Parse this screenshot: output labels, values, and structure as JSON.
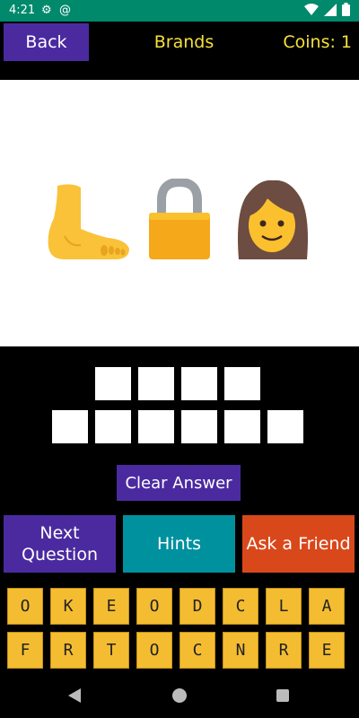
{
  "status_bar": {
    "time": "4:21"
  },
  "header": {
    "back_label": "Back",
    "category": "Brands",
    "coins": "Coins: 1"
  },
  "puzzle": {
    "emojis": [
      "foot-emoji",
      "lock-emoji",
      "woman-emoji"
    ],
    "answer_rows": [
      4,
      6
    ]
  },
  "buttons": {
    "clear": "Clear Answer",
    "next": "Next Question",
    "hints": "Hints",
    "ask": "Ask a Friend"
  },
  "letters": {
    "row1": [
      "O",
      "K",
      "E",
      "O",
      "D",
      "C",
      "L",
      "A"
    ],
    "row2": [
      "F",
      "R",
      "T",
      "O",
      "C",
      "N",
      "R",
      "E"
    ]
  },
  "colors": {
    "accent_purple": "#4b2aa0",
    "hint_teal": "#00919e",
    "ask_orange": "#d9481b",
    "tile": "#f4bd31",
    "title_yellow": "#f6e03a"
  }
}
